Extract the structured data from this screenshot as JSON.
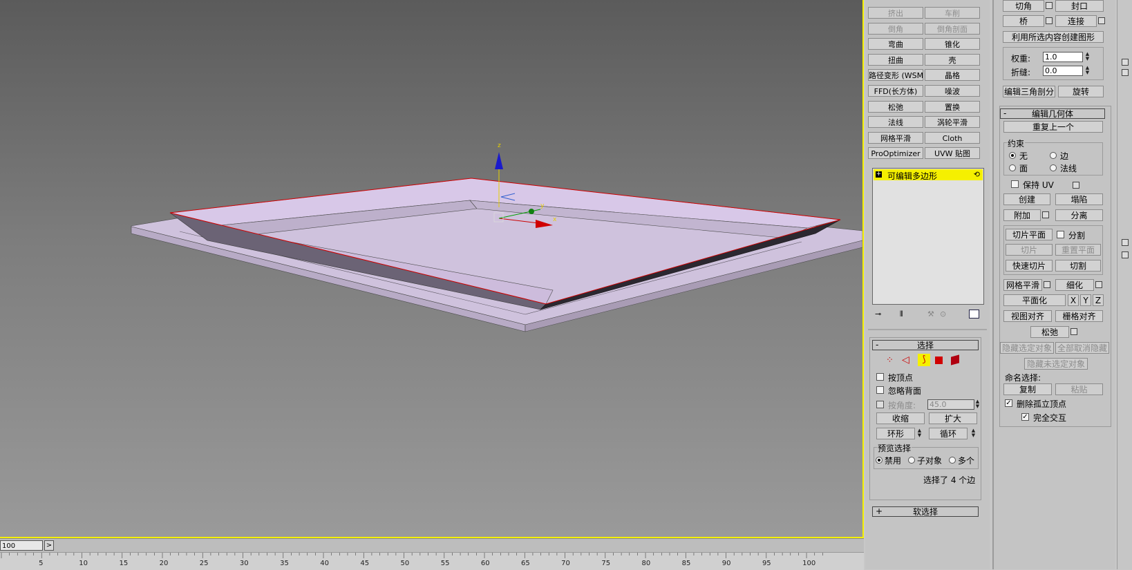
{
  "viewport": {
    "axis_labels": {
      "z": "z",
      "y": "y",
      "x": "x"
    },
    "timeline": {
      "frame_value": "100",
      "next_label": ">"
    },
    "ruler_ticks": [
      "5",
      "10",
      "15",
      "20",
      "25",
      "30",
      "35",
      "40",
      "45",
      "50",
      "55",
      "60",
      "65",
      "70",
      "75",
      "80",
      "85",
      "90",
      "95",
      "100"
    ]
  },
  "modifier_panel": {
    "modifier_buttons": [
      [
        "挤出",
        "车削"
      ],
      [
        "倒角",
        "倒角剖面"
      ],
      [
        "弯曲",
        "锥化"
      ],
      [
        "扭曲",
        "壳"
      ],
      [
        "路径变形 (WSM)",
        "晶格"
      ],
      [
        "FFD(长方体)",
        "噪波"
      ],
      [
        "松弛",
        "置换"
      ],
      [
        "法线",
        "涡轮平滑"
      ],
      [
        "网格平滑",
        "Cloth"
      ],
      [
        "ProOptimizer",
        "UVW 贴图"
      ]
    ],
    "stack_item": "可编辑多边形",
    "selection": {
      "title": "选择",
      "by_vertex": "按顶点",
      "ignore_backface": "忽略背面",
      "by_angle": "按角度:",
      "angle_value": "45.0",
      "shrink": "收缩",
      "grow": "扩大",
      "ring": "环形",
      "loop": "循环",
      "preview_title": "预览选择",
      "preview_options": [
        "禁用",
        "子对象",
        "多个"
      ],
      "status": "选择了 4 个边"
    },
    "soft_selection": {
      "title": "软选择"
    }
  },
  "edit_panel": {
    "top_buttons": {
      "chamfer": "切角",
      "cap": "封口",
      "bridge": "桥",
      "connect": "连接",
      "create_shape": "利用所选内容创建图形"
    },
    "weight_label": "权重:",
    "weight_value": "1.0",
    "crease_label": "折缝:",
    "crease_value": "0.0",
    "edit_tri": "编辑三角剖分",
    "turn": "旋转",
    "edit_geometry": {
      "title": "编辑几何体",
      "repeat_last": "重复上一个",
      "constraints_title": "约束",
      "constraints": [
        "无",
        "边",
        "面",
        "法线"
      ],
      "preserve_uv": "保持 UV",
      "create": "创建",
      "collapse": "塌陷",
      "attach": "附加",
      "detach": "分离",
      "slice_plane": "切片平面",
      "split": "分割",
      "slice": "切片",
      "reset_plane": "重置平面",
      "quickslice": "快速切片",
      "cut": "切割",
      "meshsmooth": "网格平滑",
      "tessellate": "细化",
      "make_planar": "平面化",
      "x": "X",
      "y": "Y",
      "z": "Z",
      "view_align": "视图对齐",
      "grid_align": "栅格对齐",
      "relax": "松弛",
      "hide_selected": "隐藏选定对象",
      "unhide_all": "全部取消隐藏",
      "hide_unselected": "隐藏未选定对象",
      "named_sel": "命名选择:",
      "copy": "复制",
      "paste": "粘贴",
      "delete_isolated": "删除孤立顶点",
      "full_interact": "完全交互"
    }
  },
  "colors": {
    "accent_yellow": "#f5f000",
    "frame_top": "#d9c7e6",
    "frame_dark": "#2b2830",
    "edge_red": "#d00000"
  }
}
